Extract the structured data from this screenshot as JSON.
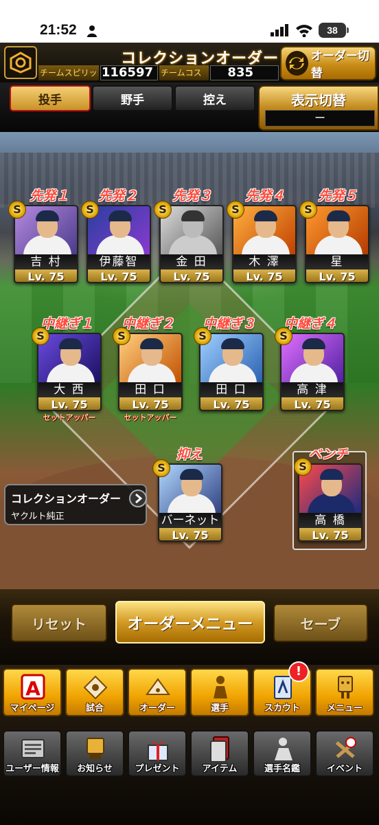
{
  "status_bar": {
    "time": "21:52",
    "battery": "38"
  },
  "header": {
    "title": "コレクションオーダー",
    "team_spirits_label": "チームスピリッツ",
    "team_spirits_value": "116597",
    "team_cost_label": "チームコスト",
    "team_cost_value": "835",
    "order_switch_label": "オーダー切替"
  },
  "tabs": [
    {
      "label": "投手",
      "active": true
    },
    {
      "label": "野手",
      "active": false
    },
    {
      "label": "控え",
      "active": false
    }
  ],
  "display_toggle": {
    "label": "表示切替",
    "value": "ー"
  },
  "starters": [
    {
      "position": "先発１",
      "name": "吉 村",
      "level": "Lv. 75"
    },
    {
      "position": "先発２",
      "name": "伊藤智",
      "level": "Lv. 75"
    },
    {
      "position": "先発３",
      "name": "金 田",
      "level": "Lv. 75"
    },
    {
      "position": "先発４",
      "name": "木 澤",
      "level": "Lv. 75"
    },
    {
      "position": "先発５",
      "name": "星",
      "level": "Lv. 75"
    }
  ],
  "relievers": [
    {
      "position": "中継ぎ１",
      "name": "大 西",
      "level": "Lv. 75",
      "sub": "セットアッパー"
    },
    {
      "position": "中継ぎ２",
      "name": "田 口",
      "level": "Lv. 75",
      "sub": "セットアッパー"
    },
    {
      "position": "中継ぎ３",
      "name": "田 口",
      "level": "Lv. 75",
      "sub": ""
    },
    {
      "position": "中継ぎ４",
      "name": "高 津",
      "level": "Lv. 75",
      "sub": ""
    }
  ],
  "closer": {
    "position": "抑え",
    "name": "バーネット",
    "level": "Lv. 75"
  },
  "bench": {
    "position": "ベンチ",
    "name": "高 橋",
    "level": "Lv. 75"
  },
  "badge_letter": "S",
  "collection_order": {
    "title": "コレクションオーダー",
    "subtitle": "ヤクルト純正"
  },
  "actions": {
    "reset": "リセット",
    "order_menu": "オーダーメニュー",
    "save": "セーブ"
  },
  "nav_primary": [
    {
      "label": "マイページ",
      "icon": "mypage-icon"
    },
    {
      "label": "試合",
      "icon": "match-icon"
    },
    {
      "label": "オーダー",
      "icon": "order-icon"
    },
    {
      "label": "選手",
      "icon": "player-icon"
    },
    {
      "label": "スカウト",
      "icon": "scout-icon"
    },
    {
      "label": "メニュー",
      "icon": "menu-icon"
    }
  ],
  "scout_notification": "!",
  "nav_secondary": [
    {
      "label": "ユーザー情報",
      "icon": "user-info-icon"
    },
    {
      "label": "お知らせ",
      "icon": "news-icon"
    },
    {
      "label": "プレゼント",
      "icon": "present-icon"
    },
    {
      "label": "アイテム",
      "icon": "item-icon"
    },
    {
      "label": "選手名鑑",
      "icon": "player-guide-icon"
    },
    {
      "label": "イベント",
      "icon": "event-icon"
    }
  ],
  "colors": {
    "accent_gold": "#d39a25",
    "position_red": "#ff4a3a",
    "tab_active_border": "#bb1111"
  }
}
